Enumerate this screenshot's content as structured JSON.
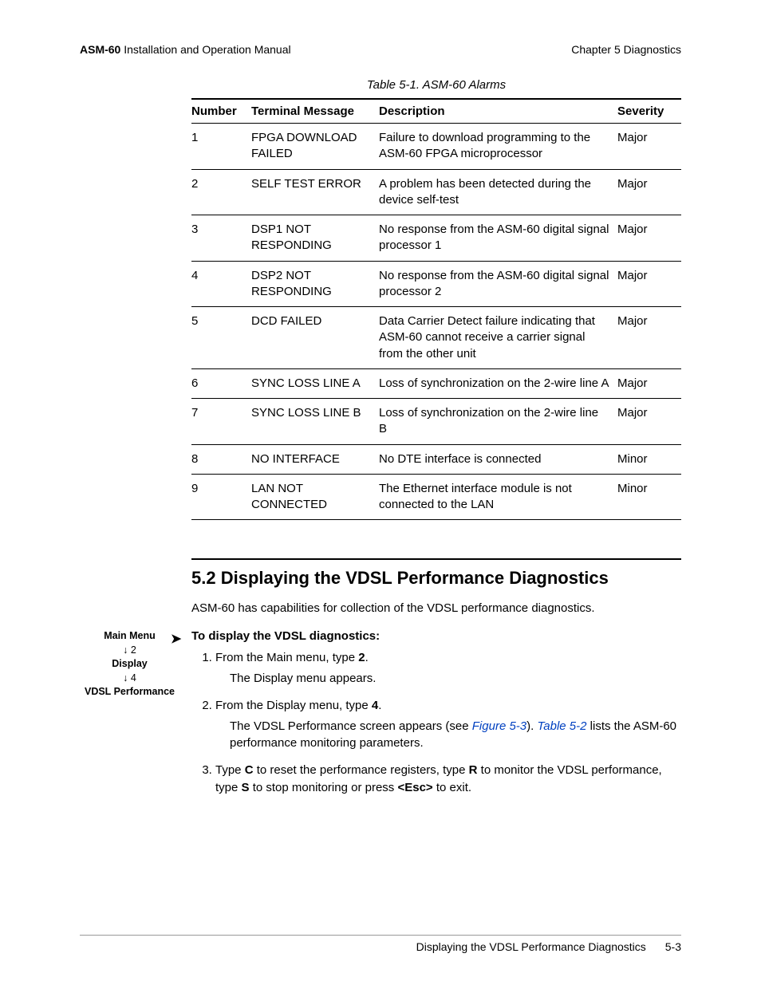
{
  "header": {
    "product": "ASM-60",
    "manual": "Installation and Operation Manual",
    "chapter": "Chapter 5  Diagnostics"
  },
  "table": {
    "caption": "Table 5-1.  ASM-60 Alarms",
    "headers": {
      "num": "Number",
      "msg": "Terminal Message",
      "desc": "Description",
      "sev": "Severity"
    },
    "rows": [
      {
        "num": "1",
        "msg": "FPGA DOWNLOAD FAILED",
        "desc": "Failure to download programming to the ASM-60 FPGA microprocessor",
        "sev": "Major"
      },
      {
        "num": "2",
        "msg": "SELF TEST ERROR",
        "desc": "A problem has been detected during the device self-test",
        "sev": "Major"
      },
      {
        "num": "3",
        "msg": "DSP1 NOT RESPONDING",
        "desc": "No response from the ASM-60 digital signal processor 1",
        "sev": "Major"
      },
      {
        "num": "4",
        "msg": "DSP2 NOT RESPONDING",
        "desc": "No response from the ASM-60 digital signal processor 2",
        "sev": "Major"
      },
      {
        "num": "5",
        "msg": "DCD FAILED",
        "desc": "Data Carrier Detect failure indicating that ASM-60 cannot receive a carrier signal from the other unit",
        "sev": "Major"
      },
      {
        "num": "6",
        "msg": "SYNC LOSS LINE A",
        "desc": "Loss of synchronization on the 2-wire line A",
        "sev": "Major"
      },
      {
        "num": "7",
        "msg": "SYNC LOSS LINE B",
        "desc": "Loss of synchronization on the 2-wire line B",
        "sev": "Major"
      },
      {
        "num": "8",
        "msg": "NO INTERFACE",
        "desc": "No DTE interface is connected",
        "sev": "Minor"
      },
      {
        "num": "9",
        "msg": "LAN NOT CONNECTED",
        "desc": "The Ethernet interface module is not connected to the LAN",
        "sev": "Minor"
      }
    ]
  },
  "section": {
    "number": "5.2",
    "title": "Displaying the VDSL Performance Diagnostics",
    "lead": "ASM-60 has capabilities for collection of the VDSL performance diagnostics.",
    "proc_head": "To display the VDSL diagnostics:",
    "side_nav": {
      "l1": "Main Menu",
      "l2": "↓ 2",
      "l3": "Display",
      "l4": "↓ 4",
      "l5": "VDSL Performance"
    },
    "steps": {
      "s1a": "From the Main menu, type ",
      "s1b": "2",
      "s1c": ".",
      "s1_sub": "The Display menu appears.",
      "s2a": "From the Display menu, type ",
      "s2b": "4",
      "s2c": ".",
      "s2_sub_a": "The VDSL Performance screen appears (see ",
      "s2_sub_fig": "Figure 5-3",
      "s2_sub_b": "). ",
      "s2_sub_tab": "Table 5-2",
      "s2_sub_c": " lists the ASM-60 performance monitoring parameters.",
      "s3a": "Type ",
      "s3b": "C",
      "s3c": " to reset the performance registers, type ",
      "s3d": "R",
      "s3e": " to monitor the VDSL performance, type ",
      "s3f": "S",
      "s3g": " to stop monitoring or press ",
      "s3h": "<Esc>",
      "s3i": " to exit."
    }
  },
  "footer": {
    "title": "Displaying the VDSL Performance Diagnostics",
    "page": "5-3"
  }
}
